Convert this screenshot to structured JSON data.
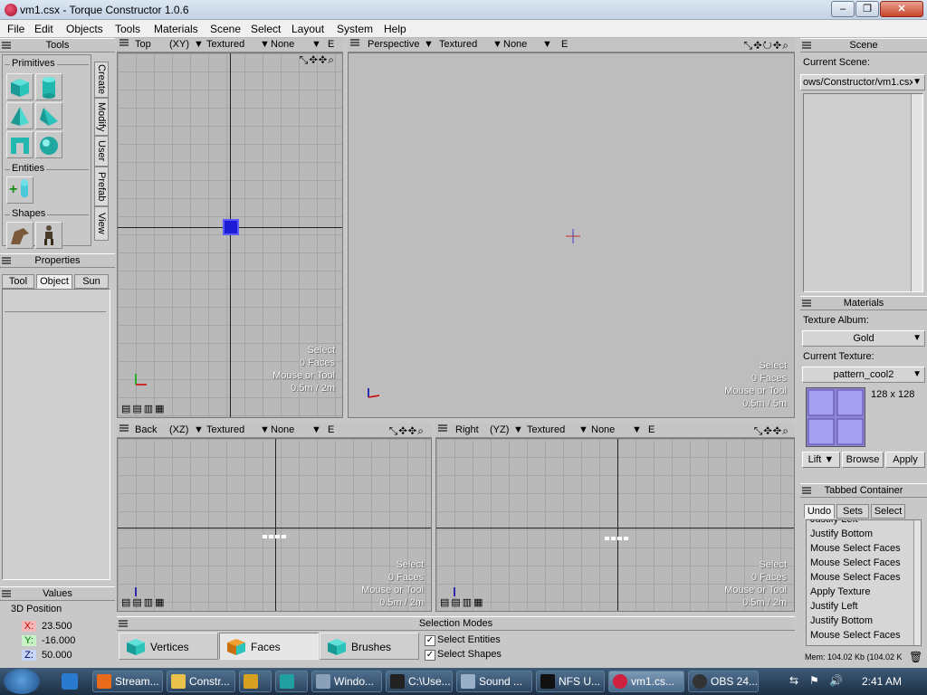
{
  "window": {
    "title": "vm1.csx - Torque Constructor 1.0.6"
  },
  "menu": [
    "File",
    "Edit",
    "Objects",
    "Tools",
    "Materials",
    "Scene",
    "Select",
    "Layout",
    "System",
    "Help"
  ],
  "tools_panel": {
    "header": "Tools",
    "groups": {
      "primitives": "Primitives",
      "entities": "Entities",
      "shapes": "Shapes"
    },
    "side_tabs": [
      "Create",
      "Modify",
      "User",
      "Prefab",
      "View"
    ]
  },
  "properties_panel": {
    "header": "Properties",
    "tabs": [
      "Tool",
      "Object",
      "Sun"
    ]
  },
  "values_panel": {
    "header": "Values",
    "section": "3D Position",
    "x_label": "X:",
    "x": "23.500",
    "y_label": "Y:",
    "y": "-16.000",
    "z_label": "Z:",
    "z": "50.000"
  },
  "viewports": {
    "top": {
      "view": "Top",
      "axes": "(XY)",
      "mode": "Textured",
      "filter": "None",
      "extra": "E",
      "info": [
        "Select",
        "0 Faces",
        "Mouse or Tool",
        "0.5m / 2m"
      ]
    },
    "perspective": {
      "view": "Perspective",
      "mode": "Textured",
      "filter": "None",
      "extra": "E",
      "info": [
        "Select",
        "0 Faces",
        "Mouse or Tool",
        "0.5m / 5m"
      ]
    },
    "back": {
      "view": "Back",
      "axes": "(XZ)",
      "mode": "Textured",
      "filter": "None",
      "extra": "E",
      "info": [
        "Select",
        "0 Faces",
        "Mouse or Tool",
        "0.5m / 2m"
      ]
    },
    "right": {
      "view": "Right",
      "axes": "(YZ)",
      "mode": "Textured",
      "filter": "None",
      "extra": "E",
      "info": [
        "Select",
        "0 Faces",
        "Mouse or Tool",
        "0.5m / 2m"
      ]
    }
  },
  "selection_modes": {
    "header": "Selection Modes",
    "vertices": "Vertices",
    "faces": "Faces",
    "brushes": "Brushes",
    "select_entities": "Select Entities",
    "select_shapes": "Select Shapes"
  },
  "scene_panel": {
    "header": "Scene",
    "current_scene_label": "Current Scene:",
    "current_scene_value": "ows/Constructor/vm1.csx"
  },
  "materials_panel": {
    "header": "Materials",
    "album_label": "Texture Album:",
    "album_value": "Gold",
    "texture_label": "Current Texture:",
    "texture_value": "pattern_cool2",
    "texture_size": "128 x 128",
    "lift_label": "Lift",
    "browse_label": "Browse",
    "apply_label": "Apply"
  },
  "tabbed_container": {
    "header": "Tabbed Container",
    "tabs": [
      "Undo",
      "Sets",
      "Select"
    ],
    "undo_items": [
      "Justify Left",
      "Justify Bottom",
      "Mouse Select Faces",
      "Mouse Select Faces",
      "Mouse Select Faces",
      "Apply Texture",
      "Justify Left",
      "Justify Bottom",
      "Mouse Select Faces"
    ],
    "memory": "Mem: 104.02 Kb (104.02 K"
  },
  "taskbar": {
    "tasks": [
      "Stream...",
      "Constr...",
      "",
      "",
      "Windo...",
      "C:\\Use...",
      "Sound ...",
      "NFS U...",
      "vm1.cs...",
      "OBS 24..."
    ],
    "clock": "2:41 AM"
  }
}
